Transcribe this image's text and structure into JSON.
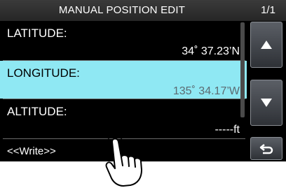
{
  "header": {
    "title": "MANUAL POSITION EDIT",
    "page": "1/1"
  },
  "rows": [
    {
      "label": "LATITUDE:",
      "value": "34˚ 37.23’N",
      "selected": false
    },
    {
      "label": "LONGITUDE:",
      "value": "135˚ 34.17’W",
      "selected": true
    },
    {
      "label": "ALTITUDE:",
      "value": "-----ft",
      "selected": false
    }
  ],
  "write": {
    "label": "<<Write>>"
  },
  "sidebar": {
    "buttons": [
      {
        "icon": "triangle-up-icon"
      },
      {
        "icon": "triangle-down-icon"
      },
      {
        "icon": "return-arrow-icon"
      }
    ]
  },
  "colors": {
    "selected_bg": "#8fe8f3",
    "screen_bg": "#000000"
  }
}
